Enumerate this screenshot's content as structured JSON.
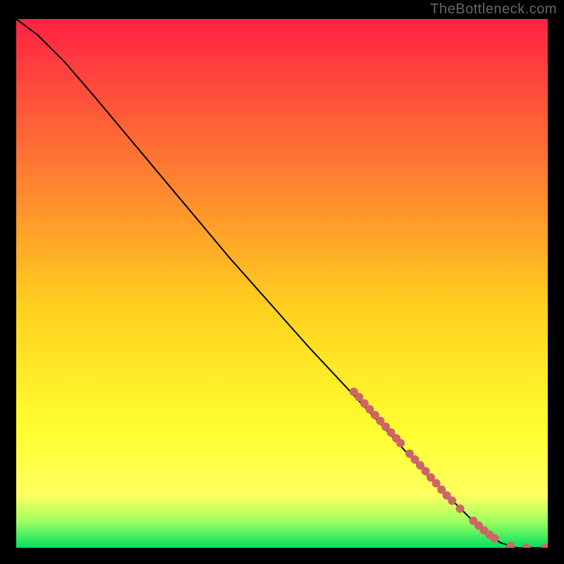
{
  "watermark": "TheBottleneck.com",
  "colors": {
    "bg_black": "#000000",
    "grad_top": "#ff2244",
    "grad_mid1": "#ff7a32",
    "grad_mid2": "#ffd21e",
    "grad_yellow": "#ffff30",
    "grad_green_light": "#9fff60",
    "grad_green": "#00e060",
    "line": "#000000",
    "marker": "#cc6666"
  },
  "chart_data": {
    "type": "line",
    "title": "",
    "xlabel": "",
    "ylabel": "",
    "xlim": [
      0,
      100
    ],
    "ylim": [
      0,
      100
    ],
    "curve": [
      {
        "x": 0,
        "y": 100
      },
      {
        "x": 4,
        "y": 97
      },
      {
        "x": 9,
        "y": 92
      },
      {
        "x": 15,
        "y": 85
      },
      {
        "x": 25,
        "y": 73
      },
      {
        "x": 40,
        "y": 55
      },
      {
        "x": 55,
        "y": 38
      },
      {
        "x": 68,
        "y": 24
      },
      {
        "x": 78,
        "y": 13
      },
      {
        "x": 86,
        "y": 5
      },
      {
        "x": 91,
        "y": 1
      },
      {
        "x": 94,
        "y": 0
      },
      {
        "x": 100,
        "y": 0
      }
    ],
    "markers": [
      {
        "x": 63.5,
        "y": 29.5
      },
      {
        "x": 64.5,
        "y": 28.5
      },
      {
        "x": 65.5,
        "y": 27.3
      },
      {
        "x": 66.5,
        "y": 26.2
      },
      {
        "x": 67.5,
        "y": 25.1
      },
      {
        "x": 68.5,
        "y": 24.0
      },
      {
        "x": 69.5,
        "y": 22.9
      },
      {
        "x": 70.5,
        "y": 21.8
      },
      {
        "x": 71.5,
        "y": 20.7
      },
      {
        "x": 72.3,
        "y": 19.8
      },
      {
        "x": 74.0,
        "y": 17.8
      },
      {
        "x": 75.0,
        "y": 16.7
      },
      {
        "x": 76.0,
        "y": 15.6
      },
      {
        "x": 77.0,
        "y": 14.5
      },
      {
        "x": 78.0,
        "y": 13.3
      },
      {
        "x": 79.0,
        "y": 12.2
      },
      {
        "x": 80.0,
        "y": 11.0
      },
      {
        "x": 81.0,
        "y": 9.9
      },
      {
        "x": 82.0,
        "y": 8.9
      },
      {
        "x": 83.5,
        "y": 7.4
      },
      {
        "x": 86.0,
        "y": 5.1
      },
      {
        "x": 87.0,
        "y": 4.2
      },
      {
        "x": 88.0,
        "y": 3.3
      },
      {
        "x": 89.0,
        "y": 2.5
      },
      {
        "x": 90.0,
        "y": 1.8
      },
      {
        "x": 93.0,
        "y": 0.3
      },
      {
        "x": 96.0,
        "y": 0.0
      },
      {
        "x": 99.5,
        "y": 0.0
      },
      {
        "x": 100.0,
        "y": 0.0
      }
    ]
  }
}
